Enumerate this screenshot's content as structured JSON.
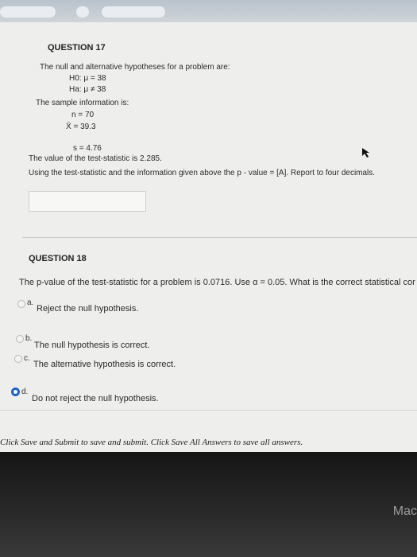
{
  "q17": {
    "title": "QUESTION 17",
    "intro": "The null and alternative hypotheses for a problem are:",
    "h0": "H0: μ = 38",
    "ha": "Ha: μ ≠ 38",
    "sample_intro": "The sample information is:",
    "n": "n = 70",
    "xbar": "X̄ = 39.3",
    "s": "s = 4.76",
    "test_stat": "The value of the test-statistic is 2.285.",
    "instruction": "Using the test-statistic and the information given above the p - value = [A]. Report to four decimals.",
    "answer_value": ""
  },
  "q18": {
    "title": "QUESTION 18",
    "prompt": "The p-value of the test-statistic for a problem is 0.0716. Use α = 0.05. What is the correct statistical cor",
    "options": [
      {
        "letter": "a.",
        "label": "Reject the null hypothesis.",
        "selected": false
      },
      {
        "letter": "b.",
        "label": "The null hypothesis is correct.",
        "selected": false
      },
      {
        "letter": "c.",
        "label": "The alternative hypothesis is correct.",
        "selected": false
      },
      {
        "letter": "d.",
        "label": "Do not reject the null hypothesis.",
        "selected": true
      }
    ]
  },
  "footer": {
    "text": "Click Save and Submit to save and submit. Click Save All Answers to save all answers."
  },
  "bezel": {
    "brand": "Mac"
  },
  "colors": {
    "accent": "#1b64c8",
    "page_bg": "#eeeeec"
  }
}
